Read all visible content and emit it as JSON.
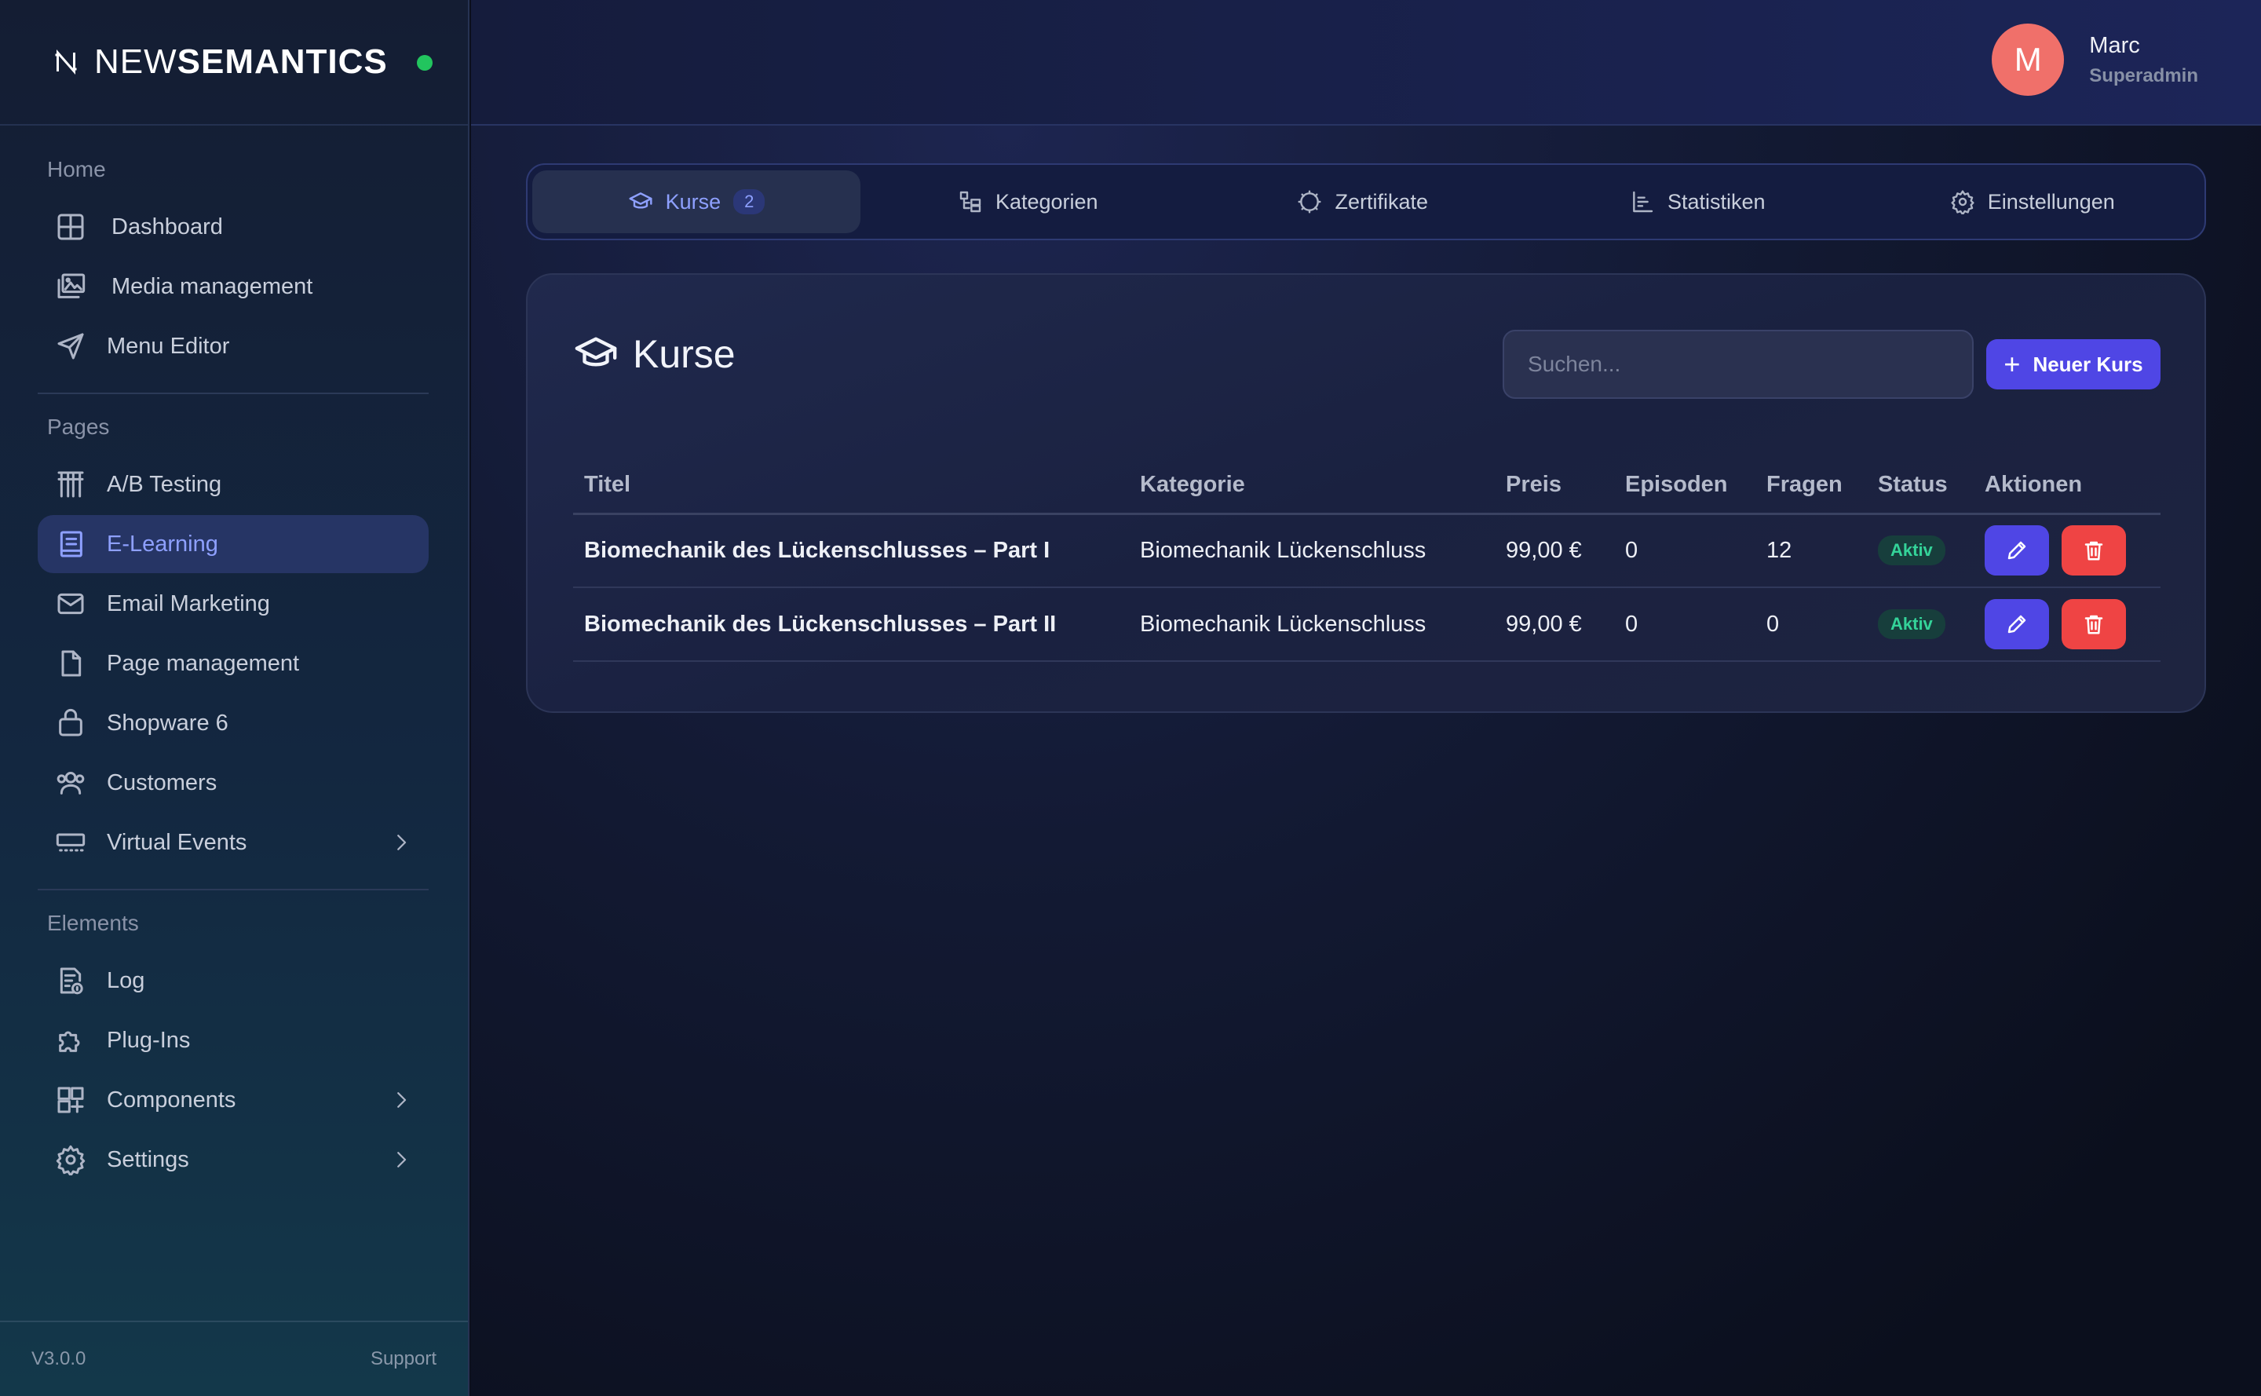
{
  "brand": {
    "prefix": "NEW",
    "suffix": "SEMANTICS"
  },
  "sidebar": {
    "sections": [
      {
        "title": "Home",
        "items": [
          {
            "label": "Dashboard",
            "icon": "grid-icon"
          },
          {
            "label": "Media management",
            "icon": "images-icon"
          },
          {
            "label": "Menu Editor",
            "icon": "send-icon"
          }
        ]
      },
      {
        "title": "Pages",
        "items": [
          {
            "label": "A/B Testing",
            "icon": "columns-icon"
          },
          {
            "label": "E-Learning",
            "icon": "book-icon",
            "active": true
          },
          {
            "label": "Email Marketing",
            "icon": "mail-icon"
          },
          {
            "label": "Page management",
            "icon": "file-icon"
          },
          {
            "label": "Shopware 6",
            "icon": "shopping-bag-icon"
          },
          {
            "label": "Customers",
            "icon": "users-icon"
          },
          {
            "label": "Virtual Events",
            "icon": "keyboard-icon",
            "expandable": true
          }
        ]
      },
      {
        "title": "Elements",
        "items": [
          {
            "label": "Log",
            "icon": "log-icon"
          },
          {
            "label": "Plug-Ins",
            "icon": "puzzle-icon"
          },
          {
            "label": "Components",
            "icon": "components-icon",
            "expandable": true
          },
          {
            "label": "Settings",
            "icon": "gear-icon",
            "expandable": true
          }
        ]
      }
    ],
    "footer": {
      "version": "V3.0.0",
      "support": "Support"
    }
  },
  "user": {
    "initial": "M",
    "name": "Marc",
    "role": "Superadmin"
  },
  "tabs": [
    {
      "label": "Kurse",
      "badge": "2",
      "icon": "graduation-cap-icon",
      "active": true
    },
    {
      "label": "Kategorien",
      "icon": "category-icon"
    },
    {
      "label": "Zertifikate",
      "icon": "certificate-icon"
    },
    {
      "label": "Statistiken",
      "icon": "chart-icon"
    },
    {
      "label": "Einstellungen",
      "icon": "gear-icon"
    }
  ],
  "card": {
    "title": "Kurse",
    "search_placeholder": "Suchen...",
    "new_button": "Neuer Kurs",
    "columns": [
      "Titel",
      "Kategorie",
      "Preis",
      "Episoden",
      "Fragen",
      "Status",
      "Aktionen"
    ],
    "rows": [
      {
        "title": "Biomechanik des Lückenschlusses – Part I",
        "category": "Biomechanik Lückenschluss",
        "price": "99,00 €",
        "episodes": "0",
        "questions": "12",
        "status": "Aktiv"
      },
      {
        "title": "Biomechanik des Lückenschlusses – Part II",
        "category": "Biomechanik Lückenschluss",
        "price": "99,00 €",
        "episodes": "0",
        "questions": "0",
        "status": "Aktiv"
      }
    ]
  },
  "colors": {
    "accent": "#4f46e5",
    "danger": "#ef4444",
    "success": "#34d399",
    "avatar": "#f0706a"
  }
}
